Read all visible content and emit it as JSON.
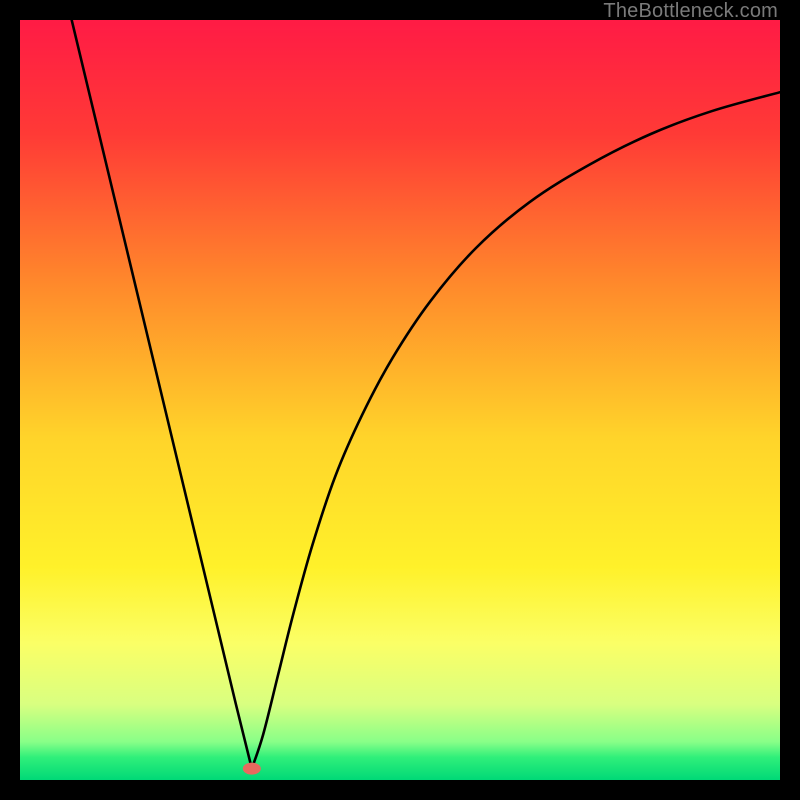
{
  "watermark": "TheBottleneck.com",
  "chart_data": {
    "type": "line",
    "title": "",
    "xlabel": "",
    "ylabel": "",
    "xlim": [
      0,
      1
    ],
    "ylim": [
      0,
      1
    ],
    "gradient_stops": [
      {
        "offset": 0.0,
        "color": "#ff1b45"
      },
      {
        "offset": 0.15,
        "color": "#ff3a36"
      },
      {
        "offset": 0.35,
        "color": "#ff8a2b"
      },
      {
        "offset": 0.55,
        "color": "#ffd42a"
      },
      {
        "offset": 0.72,
        "color": "#fff12a"
      },
      {
        "offset": 0.82,
        "color": "#fbff66"
      },
      {
        "offset": 0.9,
        "color": "#d9ff80"
      },
      {
        "offset": 0.95,
        "color": "#88ff88"
      },
      {
        "offset": 0.97,
        "color": "#30ef7a"
      },
      {
        "offset": 1.0,
        "color": "#00d977"
      }
    ],
    "dip_x": 0.305,
    "series": [
      {
        "name": "left-branch",
        "points": [
          {
            "x": 0.068,
            "y": 1.0
          },
          {
            "x": 0.092,
            "y": 0.9
          },
          {
            "x": 0.116,
            "y": 0.8
          },
          {
            "x": 0.14,
            "y": 0.7
          },
          {
            "x": 0.164,
            "y": 0.6
          },
          {
            "x": 0.188,
            "y": 0.5
          },
          {
            "x": 0.212,
            "y": 0.4
          },
          {
            "x": 0.236,
            "y": 0.3
          },
          {
            "x": 0.26,
            "y": 0.2
          },
          {
            "x": 0.284,
            "y": 0.1
          },
          {
            "x": 0.305,
            "y": 0.015
          }
        ]
      },
      {
        "name": "right-branch",
        "points": [
          {
            "x": 0.305,
            "y": 0.015
          },
          {
            "x": 0.32,
            "y": 0.06
          },
          {
            "x": 0.34,
            "y": 0.14
          },
          {
            "x": 0.36,
            "y": 0.22
          },
          {
            "x": 0.385,
            "y": 0.31
          },
          {
            "x": 0.415,
            "y": 0.4
          },
          {
            "x": 0.45,
            "y": 0.48
          },
          {
            "x": 0.49,
            "y": 0.555
          },
          {
            "x": 0.54,
            "y": 0.63
          },
          {
            "x": 0.6,
            "y": 0.7
          },
          {
            "x": 0.67,
            "y": 0.76
          },
          {
            "x": 0.75,
            "y": 0.81
          },
          {
            "x": 0.83,
            "y": 0.85
          },
          {
            "x": 0.91,
            "y": 0.88
          },
          {
            "x": 1.0,
            "y": 0.905
          }
        ]
      }
    ],
    "marker": {
      "x": 0.305,
      "y": 0.015,
      "rx": 9,
      "ry": 6,
      "color": "#e86a5e"
    }
  }
}
